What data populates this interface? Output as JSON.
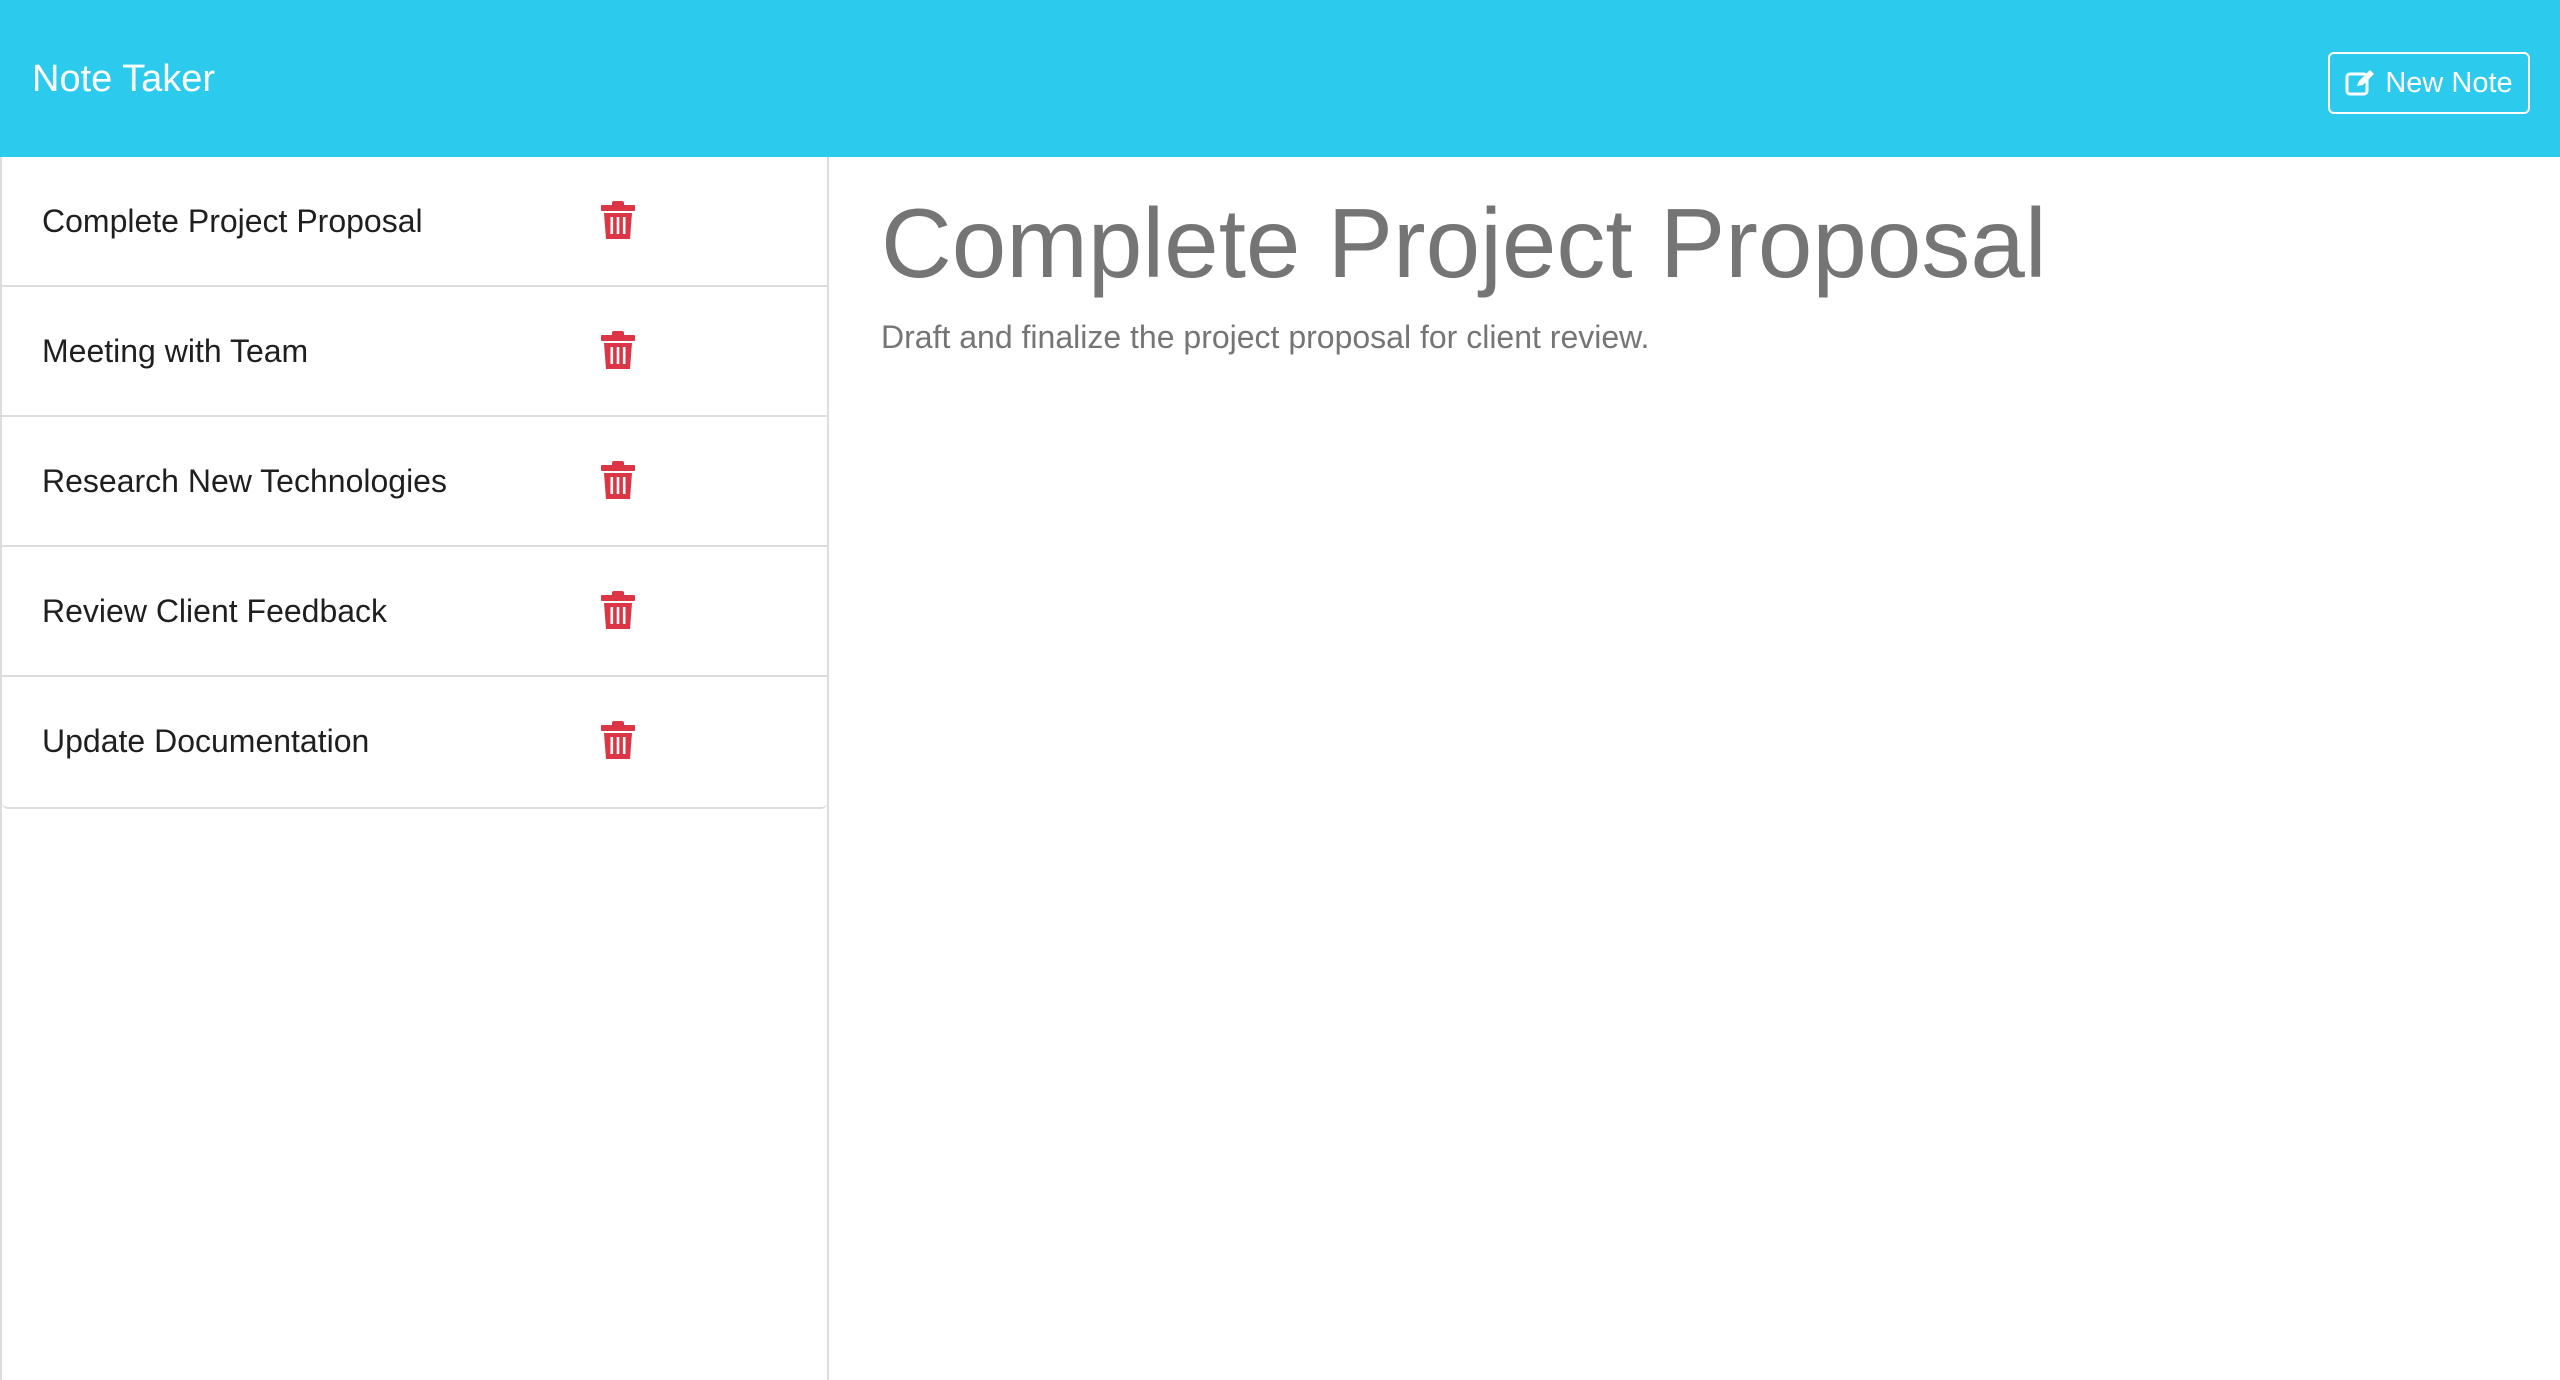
{
  "app": {
    "title": "Note Taker",
    "accent_color": "#2ccbed"
  },
  "toolbar": {
    "new_note_label": "New Note",
    "new_note_icon": "edit-icon"
  },
  "sidebar": {
    "items": [
      {
        "label": "Complete Project Proposal",
        "icon": "trash-icon"
      },
      {
        "label": "Meeting with Team",
        "icon": "trash-icon"
      },
      {
        "label": "Research New Technologies",
        "icon": "trash-icon"
      },
      {
        "label": "Review Client Feedback",
        "icon": "trash-icon"
      },
      {
        "label": "Update Documentation",
        "icon": "trash-icon"
      }
    ],
    "delete_icon_color": "#dc3545"
  },
  "main": {
    "title": "Complete Project Proposal",
    "body": "Draft and finalize the project proposal for client review."
  }
}
